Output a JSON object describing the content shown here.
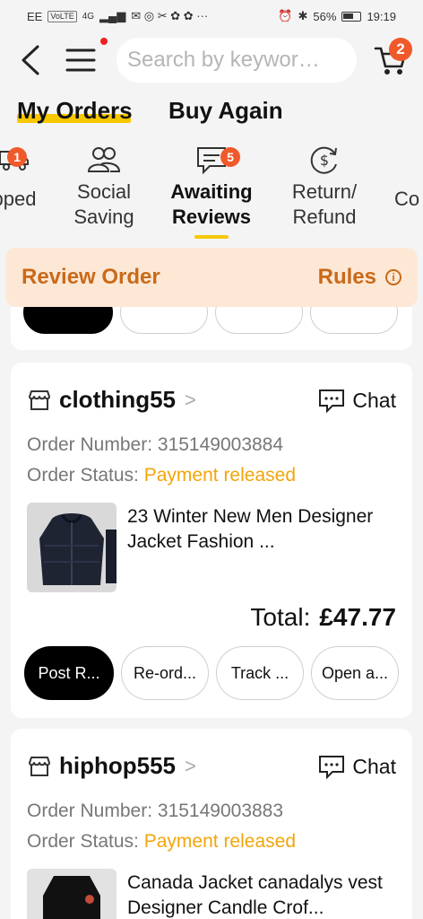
{
  "status_bar": {
    "carrier": "EE",
    "volte": "VoLTE",
    "net": "4G",
    "battery": "56%",
    "time": "19:19"
  },
  "header": {
    "search_placeholder": "Search by keywor…",
    "cart_count": "2"
  },
  "tabs": [
    {
      "label": "My Orders",
      "active": true
    },
    {
      "label": "Buy Again",
      "active": false
    }
  ],
  "categories": [
    {
      "label": "pped",
      "badge": "1"
    },
    {
      "label": "Social\nSaving"
    },
    {
      "label": "Awaiting\nReviews",
      "badge": "5",
      "active": true
    },
    {
      "label": "Return/\nRefund"
    },
    {
      "label": "Co"
    }
  ],
  "banner": {
    "title": "Review Order",
    "rules": "Rules",
    "info_glyph": "i"
  },
  "orders": [
    {
      "store": "clothing55",
      "chat": "Chat",
      "order_number_label": "Order Number:",
      "order_number": "315149003884",
      "status_label": "Order Status:",
      "status": "Payment released",
      "product": "23 Winter New Men Designer Jacket Fashion ...",
      "total_label": "Total:",
      "total": "£47.77",
      "buttons": [
        "Post R...",
        "Re-ord...",
        "Track ...",
        "Open a..."
      ]
    },
    {
      "store": "hiphop555",
      "chat": "Chat",
      "order_number_label": "Order Number:",
      "order_number": "315149003883",
      "status_label": "Order Status:",
      "status": "Payment released",
      "product": "Canada Jacket canadalys vest Designer Candle Crof..."
    }
  ],
  "colors": {
    "accent_yellow": "#f7c800",
    "badge_orange": "#f05a2b",
    "status_orange": "#f2a50b",
    "banner_bg": "#fde8d6",
    "banner_text": "#c96a1a"
  }
}
